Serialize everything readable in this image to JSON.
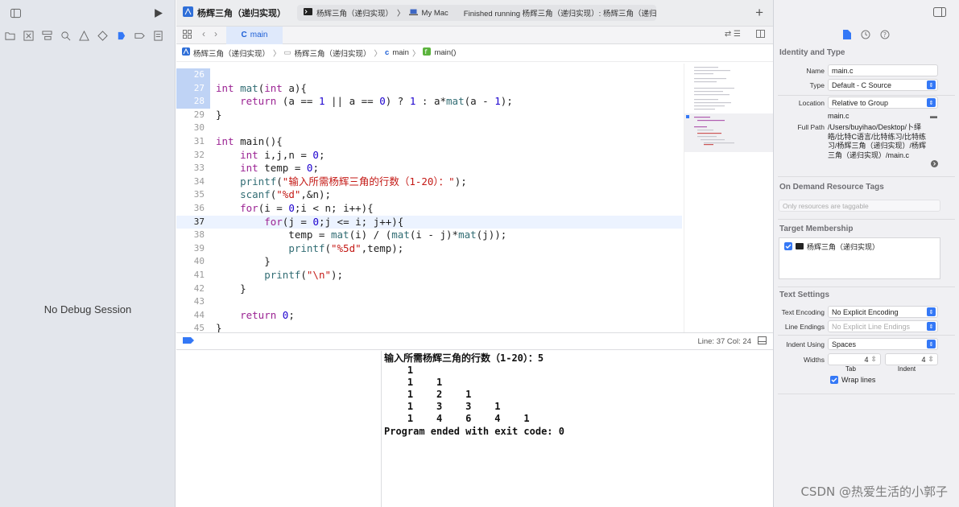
{
  "window": {
    "left_toggle_icon": "sidebar-left-icon",
    "run_icon": "play-icon"
  },
  "scheme": {
    "name": "杨辉三角（递归实现）"
  },
  "status": {
    "target": "杨辉三角（递归实现）",
    "device": "My Mac",
    "message": "Finished running 杨辉三角（递归实现）: 杨辉三角（递归实现）"
  },
  "tab": {
    "label": "main",
    "badge": "C"
  },
  "jumpbar": {
    "project": "杨辉三角（递归实现）",
    "group": "杨辉三角（递归实现）",
    "file": "main",
    "symbol": "main()"
  },
  "navigator": {
    "empty_message": "No Debug Session"
  },
  "code_lines": [
    {
      "n": "26",
      "sel": true,
      "parts": []
    },
    {
      "n": "27",
      "sel": true,
      "parts": [
        [
          "kw",
          "int"
        ],
        [
          "pl",
          " "
        ],
        [
          "fn",
          "mat"
        ],
        [
          "pl",
          "("
        ],
        [
          "kw",
          "int"
        ],
        [
          "pl",
          " a){"
        ]
      ]
    },
    {
      "n": "28",
      "sel": true,
      "parts": [
        [
          "pl",
          "    "
        ],
        [
          "kw",
          "return"
        ],
        [
          "pl",
          " (a == "
        ],
        [
          "num",
          "1"
        ],
        [
          "pl",
          " || a == "
        ],
        [
          "num",
          "0"
        ],
        [
          "pl",
          ") ? "
        ],
        [
          "num",
          "1"
        ],
        [
          "pl",
          " : a*"
        ],
        [
          "fn",
          "mat"
        ],
        [
          "pl",
          "(a - "
        ],
        [
          "num",
          "1"
        ],
        [
          "pl",
          ");"
        ]
      ]
    },
    {
      "n": "29",
      "parts": [
        [
          "pl",
          "}"
        ]
      ]
    },
    {
      "n": "30",
      "parts": []
    },
    {
      "n": "31",
      "parts": [
        [
          "kw",
          "int"
        ],
        [
          "pl",
          " main(){"
        ]
      ]
    },
    {
      "n": "32",
      "parts": [
        [
          "pl",
          "    "
        ],
        [
          "kw",
          "int"
        ],
        [
          "pl",
          " i,j,n = "
        ],
        [
          "num",
          "0"
        ],
        [
          "pl",
          ";"
        ]
      ]
    },
    {
      "n": "33",
      "parts": [
        [
          "pl",
          "    "
        ],
        [
          "kw",
          "int"
        ],
        [
          "pl",
          " temp = "
        ],
        [
          "num",
          "0"
        ],
        [
          "pl",
          ";"
        ]
      ]
    },
    {
      "n": "34",
      "parts": [
        [
          "pl",
          "    "
        ],
        [
          "fn",
          "printf"
        ],
        [
          "pl",
          "("
        ],
        [
          "str",
          "\"输入所需杨辉三角的行数（1-20）：\""
        ],
        [
          "pl",
          ");"
        ]
      ]
    },
    {
      "n": "35",
      "parts": [
        [
          "pl",
          "    "
        ],
        [
          "fn",
          "scanf"
        ],
        [
          "pl",
          "("
        ],
        [
          "str",
          "\"%d\""
        ],
        [
          "pl",
          ",&n);"
        ]
      ]
    },
    {
      "n": "36",
      "parts": [
        [
          "pl",
          "    "
        ],
        [
          "kw",
          "for"
        ],
        [
          "pl",
          "(i = "
        ],
        [
          "num",
          "0"
        ],
        [
          "pl",
          ";i < n; i++){"
        ]
      ]
    },
    {
      "n": "37",
      "cur": true,
      "parts": [
        [
          "pl",
          "        "
        ],
        [
          "kw",
          "for"
        ],
        [
          "pl",
          "(j = "
        ],
        [
          "num",
          "0"
        ],
        [
          "pl",
          ";j <= i; j++){"
        ]
      ]
    },
    {
      "n": "38",
      "parts": [
        [
          "pl",
          "            temp = "
        ],
        [
          "fn",
          "mat"
        ],
        [
          "pl",
          "(i) / ("
        ],
        [
          "fn",
          "mat"
        ],
        [
          "pl",
          "(i - j)*"
        ],
        [
          "fn",
          "mat"
        ],
        [
          "pl",
          "(j));"
        ]
      ]
    },
    {
      "n": "39",
      "parts": [
        [
          "pl",
          "            "
        ],
        [
          "fn",
          "printf"
        ],
        [
          "pl",
          "("
        ],
        [
          "str",
          "\"%5d\""
        ],
        [
          "pl",
          ",temp);"
        ]
      ]
    },
    {
      "n": "40",
      "parts": [
        [
          "pl",
          "        }"
        ]
      ]
    },
    {
      "n": "41",
      "parts": [
        [
          "pl",
          "        "
        ],
        [
          "fn",
          "printf"
        ],
        [
          "pl",
          "("
        ],
        [
          "str",
          "\"\\n\""
        ],
        [
          "pl",
          ");"
        ]
      ]
    },
    {
      "n": "42",
      "parts": [
        [
          "pl",
          "    }"
        ]
      ]
    },
    {
      "n": "43",
      "parts": []
    },
    {
      "n": "44",
      "parts": [
        [
          "pl",
          "    "
        ],
        [
          "kw",
          "return"
        ],
        [
          "pl",
          " "
        ],
        [
          "num",
          "0"
        ],
        [
          "pl",
          ";"
        ]
      ]
    },
    {
      "n": "45",
      "parts": [
        [
          "pl",
          "}"
        ]
      ]
    }
  ],
  "editor_footer": {
    "position": "Line: 37  Col: 24"
  },
  "console_output": "输入所需杨辉三角的行数（1-20）：5\n    1\n    1    1\n    1    2    1\n    1    3    3    1\n    1    4    6    4    1\nProgram ended with exit code: 0",
  "inspector": {
    "identity_title": "Identity and Type",
    "name_label": "Name",
    "name_value": "main.c",
    "type_label": "Type",
    "type_value": "Default - C Source",
    "location_label": "Location",
    "location_value": "Relative to Group",
    "location_file": "main.c",
    "fullpath_label": "Full Path",
    "fullpath_value": "/Users/buyihao/Desktop/卜绎皓/比特C语言/比特练习/比特练习/杨辉三角（递归实现）/杨辉三角（递归实现）/main.c",
    "odr_title": "On Demand Resource Tags",
    "odr_placeholder": "Only resources are taggable",
    "target_title": "Target Membership",
    "target_item": "杨辉三角（递归实现）",
    "text_title": "Text Settings",
    "encoding_label": "Text Encoding",
    "encoding_value": "No Explicit Encoding",
    "endings_label": "Line Endings",
    "endings_value": "No Explicit Line Endings",
    "indent_label": "Indent Using",
    "indent_value": "Spaces",
    "widths_label": "Widths",
    "tab_value": "4",
    "indent_width_value": "4",
    "tab_caption": "Tab",
    "indent_caption": "Indent",
    "wrap_label": "Wrap lines"
  },
  "watermark": "CSDN @热爱生活的小郭子",
  "colors": {
    "accent": "#3478f6",
    "keyword": "#9b2393",
    "number": "#1c00cf",
    "string": "#c41a16",
    "function": "#326d74"
  }
}
